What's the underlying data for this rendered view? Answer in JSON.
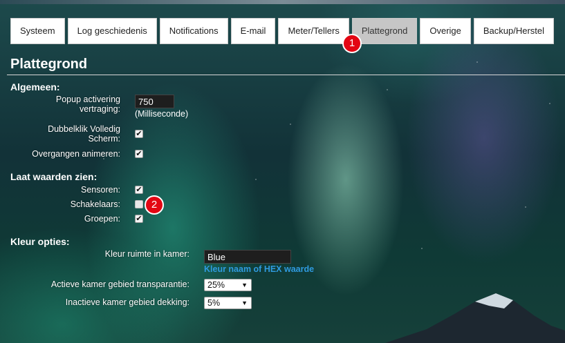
{
  "tabs": [
    {
      "label": "Systeem",
      "active": false
    },
    {
      "label": "Log geschiedenis",
      "active": false
    },
    {
      "label": "Notifications",
      "active": false
    },
    {
      "label": "E-mail",
      "active": false
    },
    {
      "label": "Meter/Tellers",
      "active": false
    },
    {
      "label": "Plattegrond",
      "active": true
    },
    {
      "label": "Overige",
      "active": false
    },
    {
      "label": "Backup/Herstel",
      "active": false
    }
  ],
  "badges": [
    "1",
    "2"
  ],
  "page_title": "Plattegrond",
  "general": {
    "title": "Algemeen:",
    "popup_label_line1": "Popup activering",
    "popup_label_line2": "vertraging:",
    "popup_value": "750",
    "popup_unit": "(Milliseconde)",
    "dblclick_line1": "Dubbelklik Volledig",
    "dblclick_line2": "Scherm:",
    "dblclick_checked": true,
    "animate_label": "Overgangen animeren:",
    "animate_checked": true
  },
  "show_values": {
    "title": "Laat waarden zien:",
    "sensors_label": "Sensoren:",
    "sensors_checked": true,
    "switches_label": "Schakelaars:",
    "switches_checked": false,
    "groups_label": "Groepen:",
    "groups_checked": true
  },
  "colors": {
    "title": "Kleur opties:",
    "room_color_label": "Kleur ruimte in kamer:",
    "room_color_value": "Blue",
    "room_color_hint": "Kleur naam of HEX waarde",
    "active_label": "Actieve kamer gebied transparantie:",
    "active_value": "25%",
    "inactive_label": "Inactieve kamer gebied dekking:",
    "inactive_value": "5%"
  },
  "theme": {
    "badge_color": "#e30613",
    "hint_color": "#2f9be0",
    "active_tab_bg": "#c6c6c6"
  }
}
